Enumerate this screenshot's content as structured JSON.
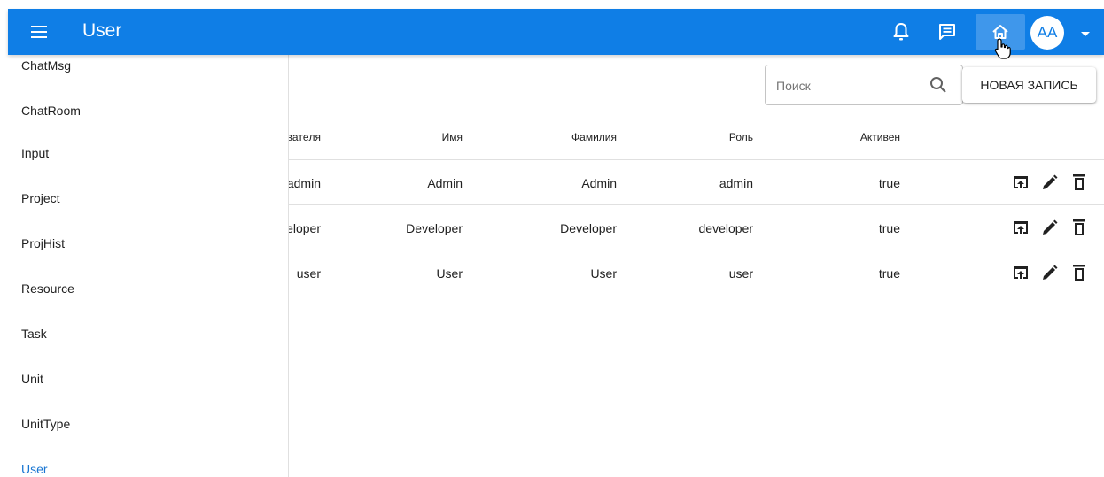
{
  "appbar": {
    "title": "User",
    "avatar_initials": "AA",
    "icons": [
      "menu-icon",
      "bell-icon",
      "chat-icon",
      "home-icon",
      "caret-down-icon"
    ],
    "color": "#0f7ee6"
  },
  "sidebar": {
    "items": [
      {
        "label": "ChatMsg"
      },
      {
        "label": "ChatRoom"
      },
      {
        "label": "Input"
      },
      {
        "label": "Project"
      },
      {
        "label": "ProjHist"
      },
      {
        "label": "Resource"
      },
      {
        "label": "Task"
      },
      {
        "label": "Unit"
      },
      {
        "label": "UnitType"
      },
      {
        "label": "User"
      }
    ],
    "active_label": "User",
    "active_color": "#1976d2"
  },
  "toolbar": {
    "search_placeholder": "Поиск",
    "search_value": "",
    "new_record_label": "НОВАЯ ЗАПИСЬ"
  },
  "table": {
    "headers": [
      "ватeля",
      "Имя",
      "Фамилия",
      "Роль",
      "Активен"
    ],
    "rows": [
      {
        "login": "admin",
        "name": "Admin",
        "last_name": "Admin",
        "role": "admin",
        "active": "true"
      },
      {
        "login": "eloper",
        "name": "Developer",
        "last_name": "Developer",
        "role": "developer",
        "active": "true"
      },
      {
        "login": "user",
        "name": "User",
        "last_name": "User",
        "role": "user",
        "active": "true"
      }
    ],
    "row_action_icons": [
      "open-icon",
      "edit-icon",
      "delete-icon"
    ]
  }
}
